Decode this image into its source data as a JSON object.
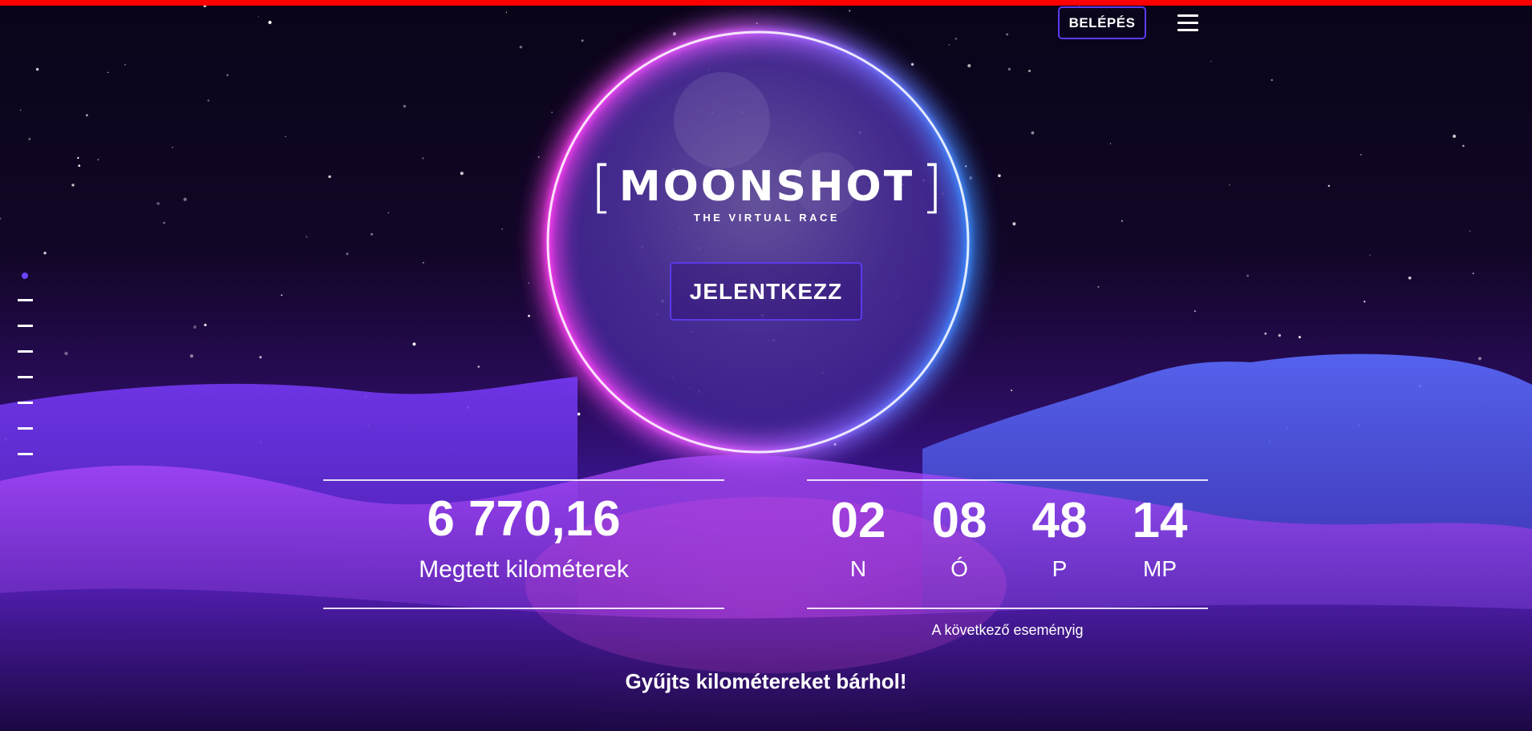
{
  "header": {
    "login_label": "BELÉPÉS",
    "accent_bar_color": "#ff0000",
    "menu_icon": "hamburger-menu-icon"
  },
  "hero": {
    "logo_text": "MOONSHOT",
    "tagline": "THE VIRTUAL RACE",
    "cta_label": "JELENTKEZZ",
    "ring_colors": [
      "#ff3cf2",
      "#3b8bff"
    ]
  },
  "side_nav": {
    "active_index": 0,
    "item_count": 8
  },
  "stats": {
    "distance_value": "6 770,16",
    "distance_label": "Megtett kilométerek"
  },
  "countdown": {
    "units": [
      {
        "value": "02",
        "label": "N"
      },
      {
        "value": "08",
        "label": "Ó"
      },
      {
        "value": "48",
        "label": "P"
      },
      {
        "value": "14",
        "label": "MP"
      }
    ],
    "caption": "A következő eseményig"
  },
  "footer": {
    "slogan": "Gyűjts kilométereket bárhol!"
  }
}
